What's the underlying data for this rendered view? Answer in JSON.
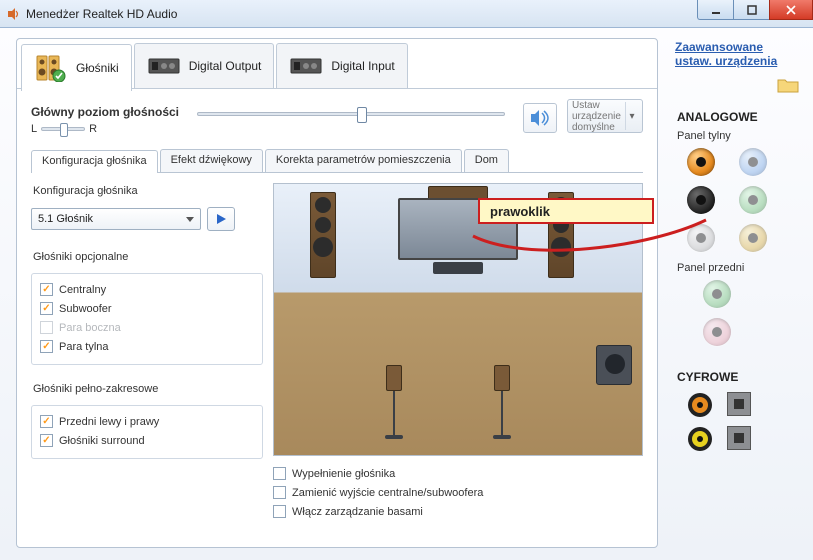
{
  "window": {
    "title": "Menedżer Realtek HD Audio"
  },
  "outer_tabs": [
    {
      "label": "Głośniki",
      "active": true
    },
    {
      "label": "Digital Output",
      "active": false
    },
    {
      "label": "Digital Input",
      "active": false
    }
  ],
  "volume": {
    "label": "Główny poziom głośności",
    "left_char": "L",
    "right_char": "R"
  },
  "default_device": {
    "line1": "Ustaw",
    "line2": "urządzenie",
    "line3": "domyślne"
  },
  "inner_tabs": [
    {
      "label": "Konfiguracja głośnika",
      "active": true
    },
    {
      "label": "Efekt dźwiękowy",
      "active": false
    },
    {
      "label": "Korekta parametrów pomieszczenia",
      "active": false
    },
    {
      "label": "Dom",
      "active": false
    }
  ],
  "speaker_config": {
    "label": "Konfiguracja głośnika",
    "selected": "5.1 Głośnik"
  },
  "optional": {
    "label": "Głośniki opcjonalne",
    "items": [
      {
        "label": "Centralny",
        "checked": true,
        "disabled": false
      },
      {
        "label": "Subwoofer",
        "checked": true,
        "disabled": false
      },
      {
        "label": "Para boczna",
        "checked": false,
        "disabled": true
      },
      {
        "label": "Para tylna",
        "checked": true,
        "disabled": false
      }
    ]
  },
  "fullrange": {
    "label": "Głośniki pełno-zakresowe",
    "items": [
      {
        "label": "Przedni lewy i prawy",
        "checked": true
      },
      {
        "label": "Głośniki surround",
        "checked": true
      }
    ]
  },
  "bottom_options": [
    {
      "label": "Wypełnienie głośnika",
      "checked": false
    },
    {
      "label": "Zamienić wyjście centralne/subwoofera",
      "checked": false
    },
    {
      "label": "Włącz zarządzanie basami",
      "checked": false
    }
  ],
  "side": {
    "advanced_link": "Zaawansowane ustaw. urządzenia",
    "analog_title": "ANALOGOWE",
    "rear_panel": "Panel tylny",
    "front_panel": "Panel przedni",
    "digital_title": "CYFROWE",
    "rear_jacks": [
      {
        "color": "#e68a1f",
        "faded": false
      },
      {
        "color": "#7aa9e6",
        "faded": true
      },
      {
        "color": "#2b2b2b",
        "faded": false
      },
      {
        "color": "#6fbf7a",
        "faded": true
      },
      {
        "color": "#bdbdbd",
        "faded": true
      },
      {
        "color": "#d8b24a",
        "faded": true
      }
    ],
    "front_jacks": [
      {
        "color": "#6fbf7a",
        "faded": true
      },
      {
        "color": "#e7a8b5",
        "faded": true
      }
    ],
    "digital_ports": [
      {
        "type": "optical",
        "color": "#e68a1f"
      },
      {
        "type": "toslink"
      },
      {
        "type": "optical",
        "color": "#e6d01f"
      },
      {
        "type": "toslink"
      }
    ]
  },
  "annotation": {
    "text": "prawoklik"
  }
}
